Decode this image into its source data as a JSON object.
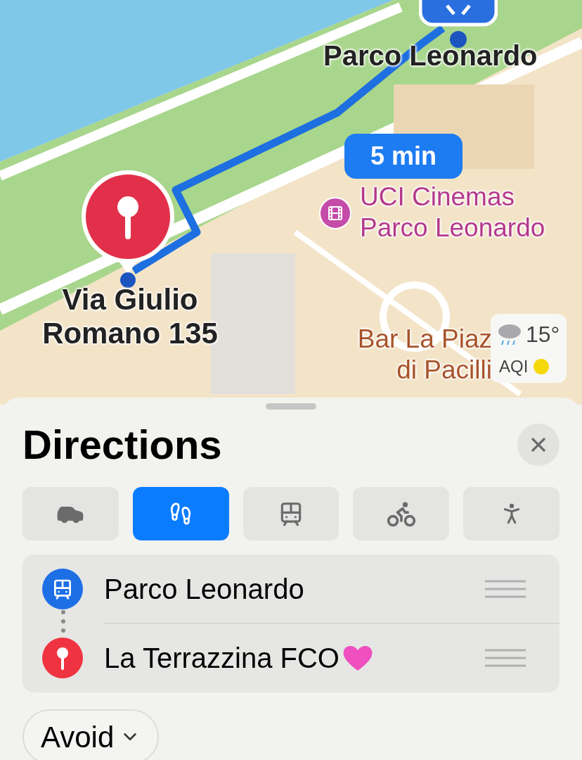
{
  "map": {
    "kind": "picture",
    "pins": [
      {
        "kind": "station",
        "label": "Parco Leonardo"
      },
      {
        "kind": "destination",
        "label": "Via Giulio Romano 135"
      }
    ],
    "route_time": "5 min",
    "pois": [
      {
        "kind": "cinema",
        "lines": [
          "UCI Cinemas",
          "Parco Leonardo"
        ]
      },
      {
        "kind": "bar",
        "lines": [
          "Bar La Piaz",
          "di Pacilli"
        ]
      }
    ],
    "weather": {
      "temperature": "15°",
      "aqi_label": "AQI"
    }
  },
  "sheet": {
    "title": "Directions",
    "modes": [
      {
        "kind": "car",
        "selected": false
      },
      {
        "kind": "walk",
        "selected": true
      },
      {
        "kind": "transit",
        "selected": false
      },
      {
        "kind": "bike",
        "selected": false
      },
      {
        "kind": "ride",
        "selected": false
      }
    ],
    "waypoints": [
      {
        "kind": "station",
        "label": "Parco Leonardo"
      },
      {
        "kind": "destination",
        "label": "La Terrazzina FCO",
        "heart": true
      }
    ],
    "avoid": "Avoid"
  }
}
